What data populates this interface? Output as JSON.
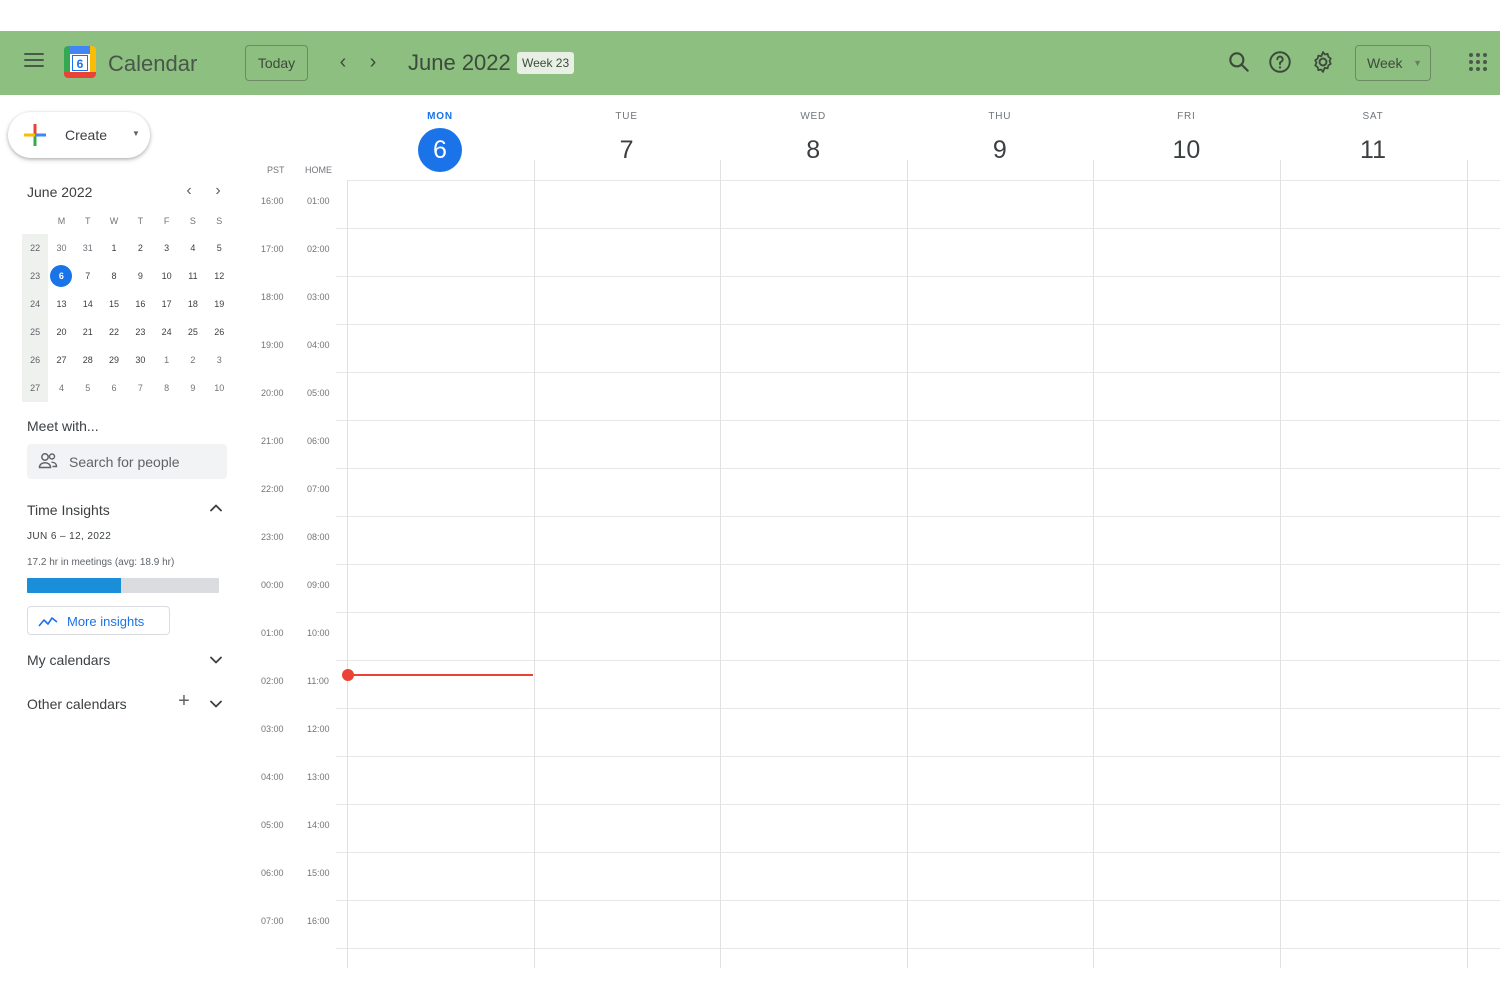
{
  "header": {
    "app_title": "Calendar",
    "logo_day": "6",
    "today_label": "Today",
    "prev_icon": "chevron-left-icon",
    "next_icon": "chevron-right-icon",
    "period_title": "June 2022",
    "week_badge": "Week 23",
    "view_label": "Week",
    "accent_color": "#8dbf80"
  },
  "sidebar": {
    "create_label": "Create",
    "mini_calendar": {
      "title": "June 2022",
      "weekday_labels": [
        "M",
        "T",
        "W",
        "T",
        "F",
        "S",
        "S"
      ],
      "weeks": [
        {
          "wk": "22",
          "days": [
            "30",
            "31",
            "1",
            "2",
            "3",
            "4",
            "5"
          ]
        },
        {
          "wk": "23",
          "days": [
            "6",
            "7",
            "8",
            "9",
            "10",
            "11",
            "12"
          ]
        },
        {
          "wk": "24",
          "days": [
            "13",
            "14",
            "15",
            "16",
            "17",
            "18",
            "19"
          ]
        },
        {
          "wk": "25",
          "days": [
            "20",
            "21",
            "22",
            "23",
            "24",
            "25",
            "26"
          ]
        },
        {
          "wk": "26",
          "days": [
            "27",
            "28",
            "29",
            "30",
            "1",
            "2",
            "3"
          ]
        },
        {
          "wk": "27",
          "days": [
            "4",
            "5",
            "6",
            "7",
            "8",
            "9",
            "10"
          ]
        }
      ],
      "selected": "6"
    },
    "meet_title": "Meet with...",
    "people_search_placeholder": "Search for people",
    "time_insights": {
      "title": "Time Insights",
      "range": "JUN 6 – 12, 2022",
      "summary": "17.2 hr in meetings (avg: 18.9 hr)",
      "progress_fraction": 0.49,
      "more_label": "More insights"
    },
    "my_calendars": "My calendars",
    "other_calendars": "Other calendars"
  },
  "grid": {
    "tz_primary": "PST",
    "tz_secondary": "HOME",
    "days": [
      {
        "dow": "MON",
        "num": "6",
        "today": true
      },
      {
        "dow": "TUE",
        "num": "7"
      },
      {
        "dow": "WED",
        "num": "8"
      },
      {
        "dow": "THU",
        "num": "9"
      },
      {
        "dow": "FRI",
        "num": "10"
      },
      {
        "dow": "SAT",
        "num": "11"
      }
    ],
    "times_primary": [
      "16:00",
      "17:00",
      "18:00",
      "19:00",
      "20:00",
      "21:00",
      "22:00",
      "23:00",
      "00:00",
      "01:00",
      "02:00",
      "03:00",
      "04:00",
      "05:00",
      "06:00",
      "07:00"
    ],
    "times_secondary": [
      "01:00",
      "02:00",
      "03:00",
      "04:00",
      "05:00",
      "06:00",
      "07:00",
      "08:00",
      "09:00",
      "10:00",
      "11:00",
      "12:00",
      "13:00",
      "14:00",
      "15:00",
      "16:00"
    ],
    "now_indicator_color": "#ea4335"
  }
}
